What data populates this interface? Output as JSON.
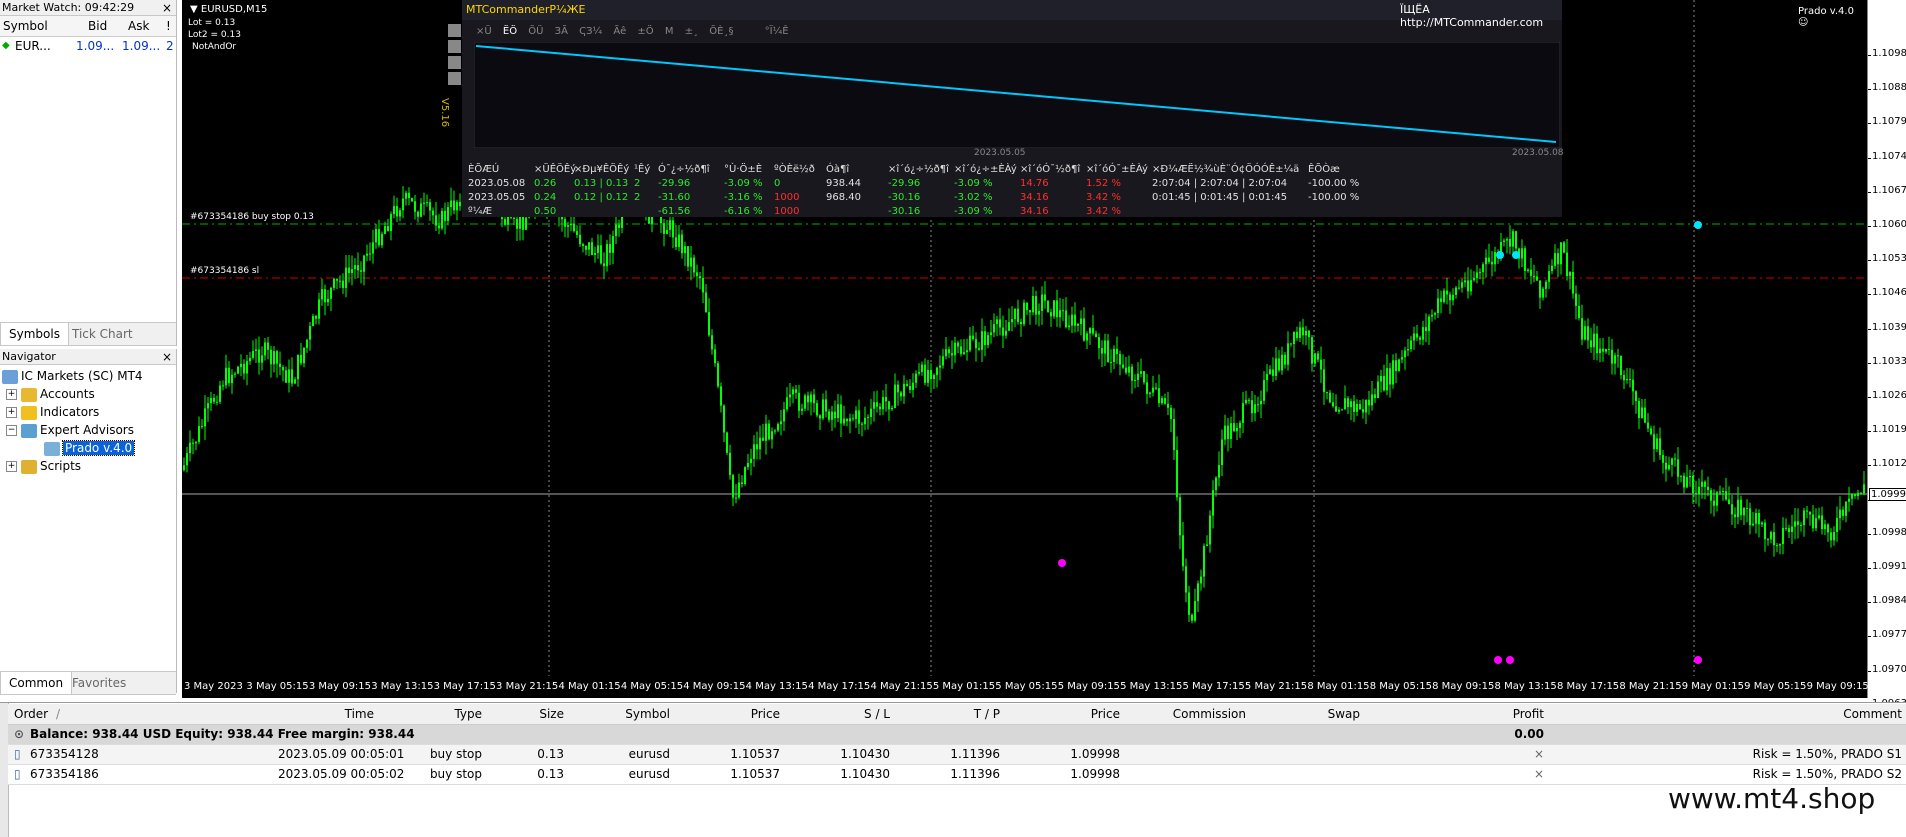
{
  "market_watch": {
    "title": "Market Watch: 09:42:29",
    "cols": [
      "Symbol",
      "Bid",
      "Ask",
      "!"
    ],
    "rows": [
      {
        "symbol": "EUR...",
        "bid": "1.09...",
        "ask": "1.09...",
        "spread": "2"
      }
    ],
    "tabs": [
      "Symbols",
      "Tick Chart"
    ]
  },
  "navigator": {
    "title": "Navigator",
    "items": [
      {
        "label": "IC Markets (SC) MT4"
      },
      {
        "label": "Accounts"
      },
      {
        "label": "Indicators"
      },
      {
        "label": "Expert Advisors"
      },
      {
        "label": "Prado v.4.0"
      },
      {
        "label": "Scripts"
      }
    ],
    "tabs": [
      "Common",
      "Favorites"
    ]
  },
  "chart": {
    "symbol_title": "EURUSD,M15",
    "lot": "Lot = 0.13",
    "lot2": "Lot2 = 0.13",
    "mode": "NotAndOr",
    "ea_label": "Prado v.4.0",
    "buy_stop_label": "#673354186 buy stop 0.13",
    "sl_label": "#673354186 sl",
    "current_price": "1.09996",
    "price_ticks": [
      "1.10980",
      "1.10885",
      "1.10790",
      "1.10740",
      "1.10675",
      "1.10605",
      "1.10535",
      "1.10465",
      "1.10395",
      "1.10330",
      "1.10260",
      "1.10190",
      "1.10120",
      "1.10050",
      "1.09985",
      "1.09915",
      "1.09845",
      "1.09775",
      "1.09705",
      "1.09635"
    ],
    "time_ticks": [
      "3 May 2023",
      "3 May 05:15",
      "3 May 09:15",
      "3 May 13:15",
      "3 May 17:15",
      "3 May 21:15",
      "4 May 01:15",
      "4 May 05:15",
      "4 May 09:15",
      "4 May 13:15",
      "4 May 17:15",
      "4 May 21:15",
      "5 May 01:15",
      "5 May 05:15",
      "5 May 09:15",
      "5 May 13:15",
      "5 May 17:15",
      "5 May 21:15",
      "8 May 01:15",
      "8 May 05:15",
      "8 May 09:15",
      "8 May 13:15",
      "8 May 17:15",
      "8 May 21:15",
      "9 May 01:15",
      "9 May 05:15",
      "9 May 09:15"
    ],
    "colors": {
      "bull": "#00ff00",
      "bg": "#000000",
      "buy_stop_line": "#00b000",
      "sl_line": "#d00000",
      "arrow_cyan": "#00e5ff",
      "arrow_magenta": "#ff00ff"
    }
  },
  "info_panel": {
    "title": "MTCommanderР¼ЖЕ",
    "url": "ЇЩЁА http://MTCommander.com",
    "menu": [
      "×Ü",
      "ЁÖ",
      "ÕÜ",
      "ЗÃ",
      "ҀЗ¼",
      "Ãê",
      "±Ö",
      "M",
      "±¸",
      "ÕÈ¸§",
      "°Ï¼Ê"
    ],
    "version": "V5.16",
    "date_mid": "2023.05.05",
    "date_end": "2023.05.08",
    "headers": [
      "ÈÕÆÚ",
      "×ÜÊÖÊý",
      "×Ðµ¥ÊÖÊý",
      "¹Êý",
      "Ó¯¿÷½ð¶î",
      "°Ù·Ö±È",
      "ºÒÈë½ð",
      "Óà¶î",
      "×î´ó¿÷½ð¶î",
      "×î´ó¿÷±ÈÀý",
      "×î´óÓ¯½ð¶î",
      "×î´óÓ¯±ÈÀý",
      "×Ð¼ÆË½¾ùÈ¨Ó¢ÖÓÓÊ±¼ä",
      "ÊÕÒæ"
    ],
    "rows": [
      [
        "2023.05.08",
        "0.26",
        "0.13 | 0.13",
        "2",
        "-29.96",
        "-3.09 %",
        "0",
        "938.44",
        "-29.96",
        "-3.09 %",
        "14.76",
        "1.52 %",
        "2:07:04 | 2:07:04 | 2:07:04",
        "-100.00 %"
      ],
      [
        "2023.05.05",
        "0.24",
        "0.12 | 0.12",
        "2",
        "-31.60",
        "-3.16 %",
        "1000",
        "968.40",
        "-30.16",
        "-3.02 %",
        "34.16",
        "3.42 %",
        "0:01:45 | 0:01:45 | 0:01:45",
        "-100.00 %"
      ],
      [
        "º¼Æ",
        "0.50",
        "",
        "",
        "-61.56",
        "-6.16 %",
        "1000",
        "",
        "-30.16",
        "-3.09 %",
        "34.16",
        "3.42 %",
        "",
        ""
      ]
    ],
    "line_color": "#00c8ff"
  },
  "terminal": {
    "cols": [
      "Order",
      "/",
      "Time",
      "Type",
      "Size",
      "Symbol",
      "Price",
      "S / L",
      "T / P",
      "Price",
      "Commission",
      "Swap",
      "Profit",
      "Comment"
    ],
    "balance_line": "Balance: 938.44 USD  Equity: 938.44  Free margin: 938.44",
    "balance_profit": "0.00",
    "orders": [
      {
        "order": "673354128",
        "time": "2023.05.09 00:05:01",
        "type": "buy stop",
        "size": "0.13",
        "symbol": "eurusd",
        "price": "1.10537",
        "sl": "1.10430",
        "tp": "1.11396",
        "cur": "1.09998",
        "close": "×",
        "comment": "Risk = 1.50%, PRADO S1"
      },
      {
        "order": "673354186",
        "time": "2023.05.09 00:05:02",
        "type": "buy stop",
        "size": "0.13",
        "symbol": "eurusd",
        "price": "1.10537",
        "sl": "1.10430",
        "tp": "1.11396",
        "cur": "1.09998",
        "close": "×",
        "comment": "Risk = 1.50%, PRADO S2"
      }
    ]
  },
  "watermark": "www.mt4.shop"
}
